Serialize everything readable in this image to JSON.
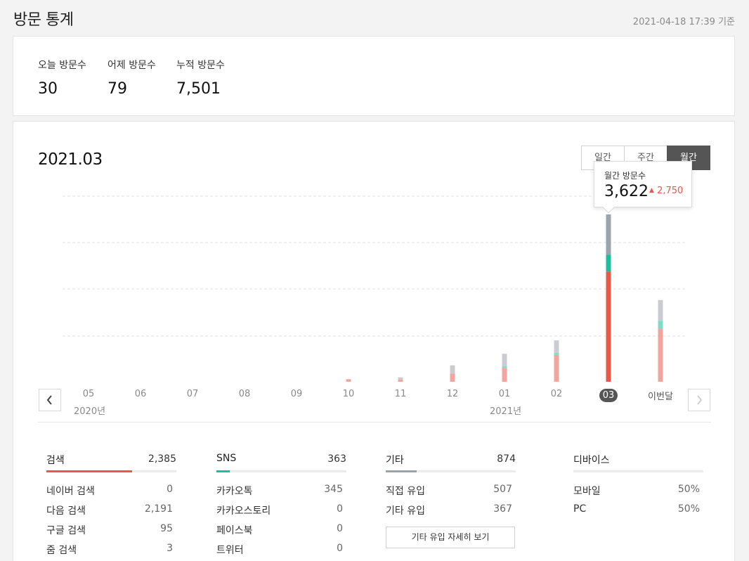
{
  "header": {
    "title": "방문 통계",
    "timestamp": "2021-04-18 17:39 기준"
  },
  "summary": {
    "items": [
      {
        "label": "오늘 방문수",
        "value": "30"
      },
      {
        "label": "어제 방문수",
        "value": "79"
      },
      {
        "label": "누적 방문수",
        "value": "7,501"
      }
    ]
  },
  "chart_section": {
    "title": "2021.03",
    "tabs": [
      {
        "label": "일간",
        "active": false
      },
      {
        "label": "주간",
        "active": false
      },
      {
        "label": "월간",
        "active": true
      }
    ],
    "tooltip": {
      "label": "월간 방문수",
      "value": "3,622",
      "delta_icon": "up-triangle-icon",
      "delta": "2,750"
    },
    "nav": {
      "prev_icon": "chevron-left-icon",
      "next_icon": "chevron-right-icon"
    },
    "year_labels": [
      "2020년",
      "2021년"
    ]
  },
  "chart_data": {
    "type": "bar",
    "stacked": true,
    "categories": [
      "05",
      "06",
      "07",
      "08",
      "09",
      "10",
      "11",
      "12",
      "01",
      "02",
      "03",
      "이번달"
    ],
    "selected_category": "03",
    "series": [
      {
        "values": [
          0,
          0,
          0,
          0,
          0,
          55,
          50,
          180,
          290,
          580,
          2385,
          1140
        ]
      },
      {
        "values": [
          0,
          0,
          0,
          0,
          0,
          0,
          0,
          0,
          25,
          45,
          363,
          180
        ]
      },
      {
        "values": [
          0,
          0,
          0,
          0,
          0,
          0,
          30,
          175,
          270,
          270,
          874,
          450
        ]
      }
    ],
    "colors": {
      "search": "#e8574a",
      "search_faded": "#f1a59c",
      "sns": "#1cbf9c",
      "sns_faded": "#7fdcc6",
      "etc": "#9aa3ae",
      "etc_faded": "#c9cdd2"
    },
    "ylim": [
      0,
      3622
    ],
    "grid": true
  },
  "sources": {
    "search": {
      "title": "검색",
      "total": "2,385",
      "share": 0.66,
      "color": "#e8574a",
      "rows": [
        {
          "label": "네이버 검색",
          "value": "0"
        },
        {
          "label": "다음 검색",
          "value": "2,191"
        },
        {
          "label": "구글 검색",
          "value": "95"
        },
        {
          "label": "줌 검색",
          "value": "3"
        }
      ]
    },
    "sns": {
      "title": "SNS",
      "total": "363",
      "share": 0.1,
      "color": "#1cbf9c",
      "rows": [
        {
          "label": "카카오톡",
          "value": "345"
        },
        {
          "label": "카카오스토리",
          "value": "0"
        },
        {
          "label": "페이스북",
          "value": "0"
        },
        {
          "label": "트위터",
          "value": "0"
        }
      ]
    },
    "etc": {
      "title": "기타",
      "total": "874",
      "share": 0.24,
      "color": "#9aa3ae",
      "rows": [
        {
          "label": "직접 유입",
          "value": "507"
        },
        {
          "label": "기타 유입",
          "value": "367"
        }
      ],
      "detail_button": "기타 유입 자세히 보기"
    },
    "device": {
      "title": "디바이스",
      "rows": [
        {
          "label": "모바일",
          "value": "50%"
        },
        {
          "label": "PC",
          "value": "50%"
        }
      ]
    }
  }
}
